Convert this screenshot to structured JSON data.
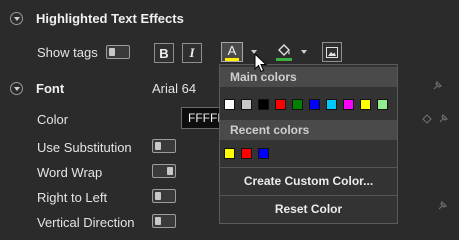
{
  "highlighted": {
    "title": "Highlighted Text Effects",
    "show_tags_label": "Show tags",
    "bold_label": "B",
    "italic_label": "I",
    "text_color_label": "A"
  },
  "font": {
    "title": "Font",
    "value": "Arial 64",
    "color_label": "Color",
    "color_value": "FFFFFFFF",
    "use_substitution_label": "Use Substitution",
    "word_wrap_label": "Word Wrap",
    "right_to_left_label": "Right to Left",
    "vertical_direction_label": "Vertical Direction"
  },
  "colors": {
    "text_color_underline": "#ffee00",
    "highlight_underline": "#3cb043"
  },
  "color_popup": {
    "main_colors_label": "Main colors",
    "recent_colors_label": "Recent colors",
    "main_colors": [
      "#ffffff",
      "#c8c8c8",
      "#000000",
      "#ff0000",
      "#008000",
      "#0000ff",
      "#00c8ff",
      "#ff00ff",
      "#ffff00",
      "#90ee90"
    ],
    "recent_colors": [
      "#ffff00",
      "#ff0000",
      "#0000ff"
    ],
    "create_custom_label": "Create Custom Color...",
    "reset_label": "Reset Color"
  },
  "icons": [
    "collapse-icon",
    "image-icon",
    "paint-bucket-icon",
    "cursor-icon",
    "pin-icon",
    "diamond-icon"
  ]
}
